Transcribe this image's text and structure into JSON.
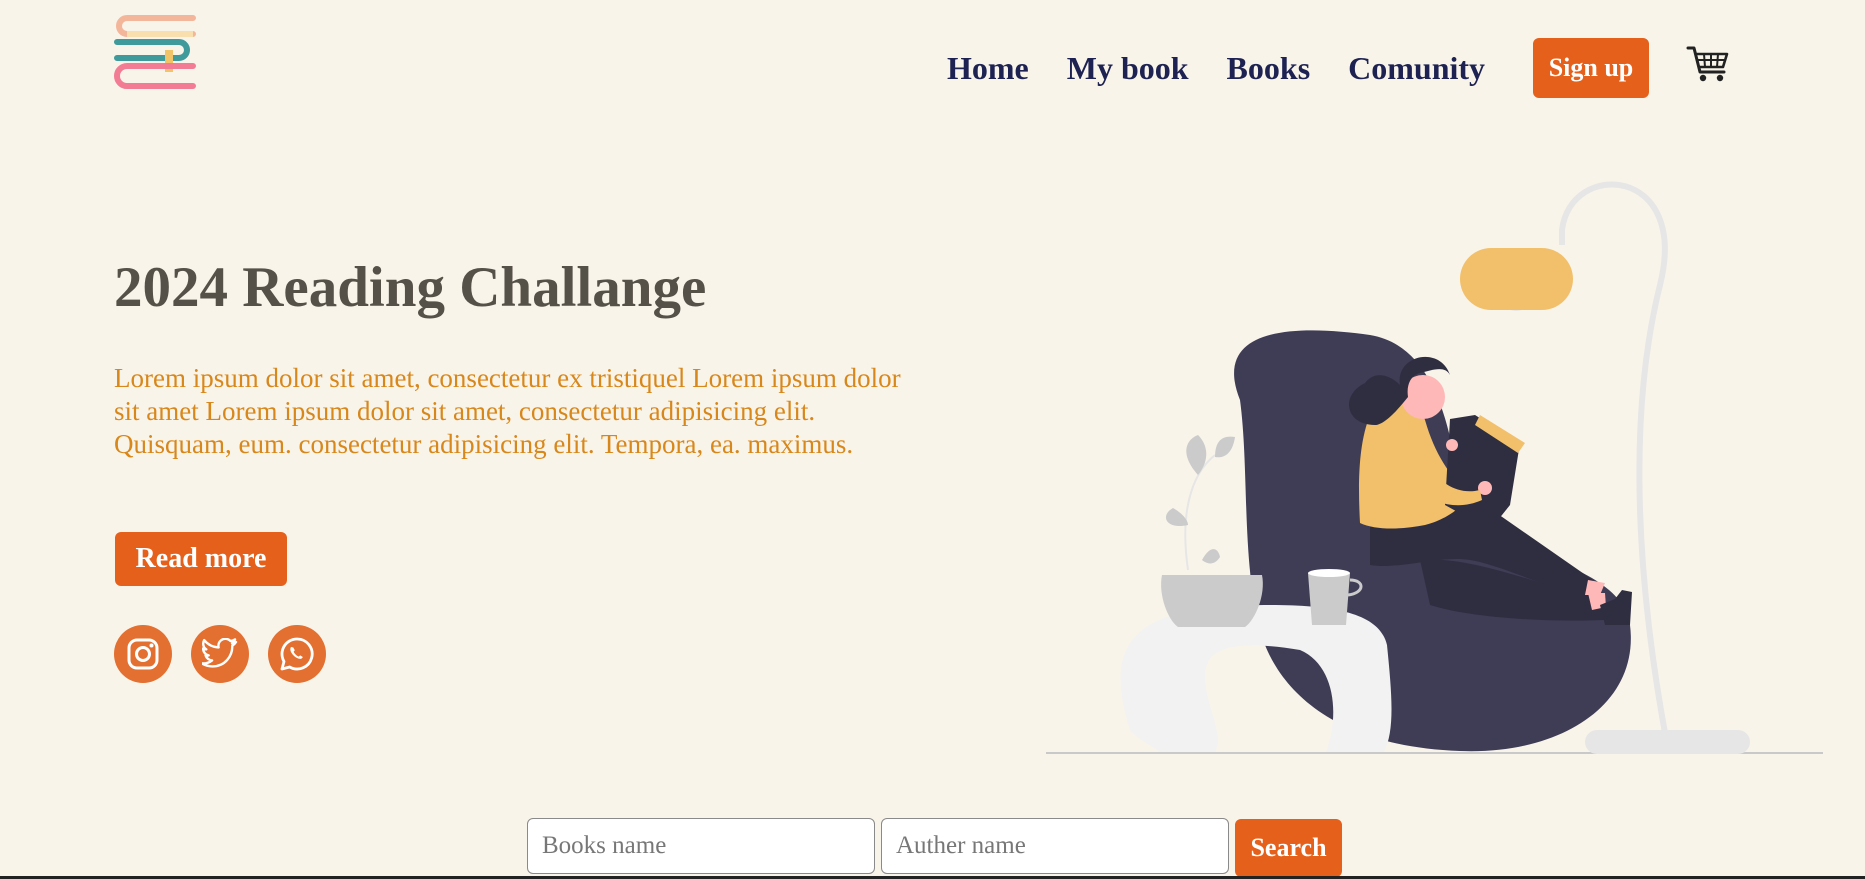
{
  "header": {
    "logo": "stacked-books-logo-icon",
    "nav": [
      "Home",
      "My book",
      "Books",
      "Comunity"
    ],
    "signup_label": "Sign up",
    "cart_icon": "shopping-cart-icon"
  },
  "hero": {
    "title": "2024 Reading Challange",
    "text": "Lorem ipsum dolor sit amet, consectetur ex tristiquel Lorem ipsum dolor sit amet Lorem ipsum dolor sit amet, consectetur adipisicing elit. Quisquam, eum. consectetur adipisicing elit. Tempora, ea. maximus.",
    "readmore_label": "Read more",
    "social": [
      "instagram-icon",
      "twitter-icon",
      "whatsapp-icon"
    ],
    "illustration": "woman-reading-in-beanbag-illustration"
  },
  "search": {
    "books_placeholder": "Books name",
    "author_placeholder": "Auther name",
    "button_label": "Search"
  },
  "colors": {
    "background": "#f9f4ea",
    "accent": "#e5601a",
    "nav_text": "#1d2252",
    "title": "#555048",
    "body_text": "#d8871a"
  }
}
